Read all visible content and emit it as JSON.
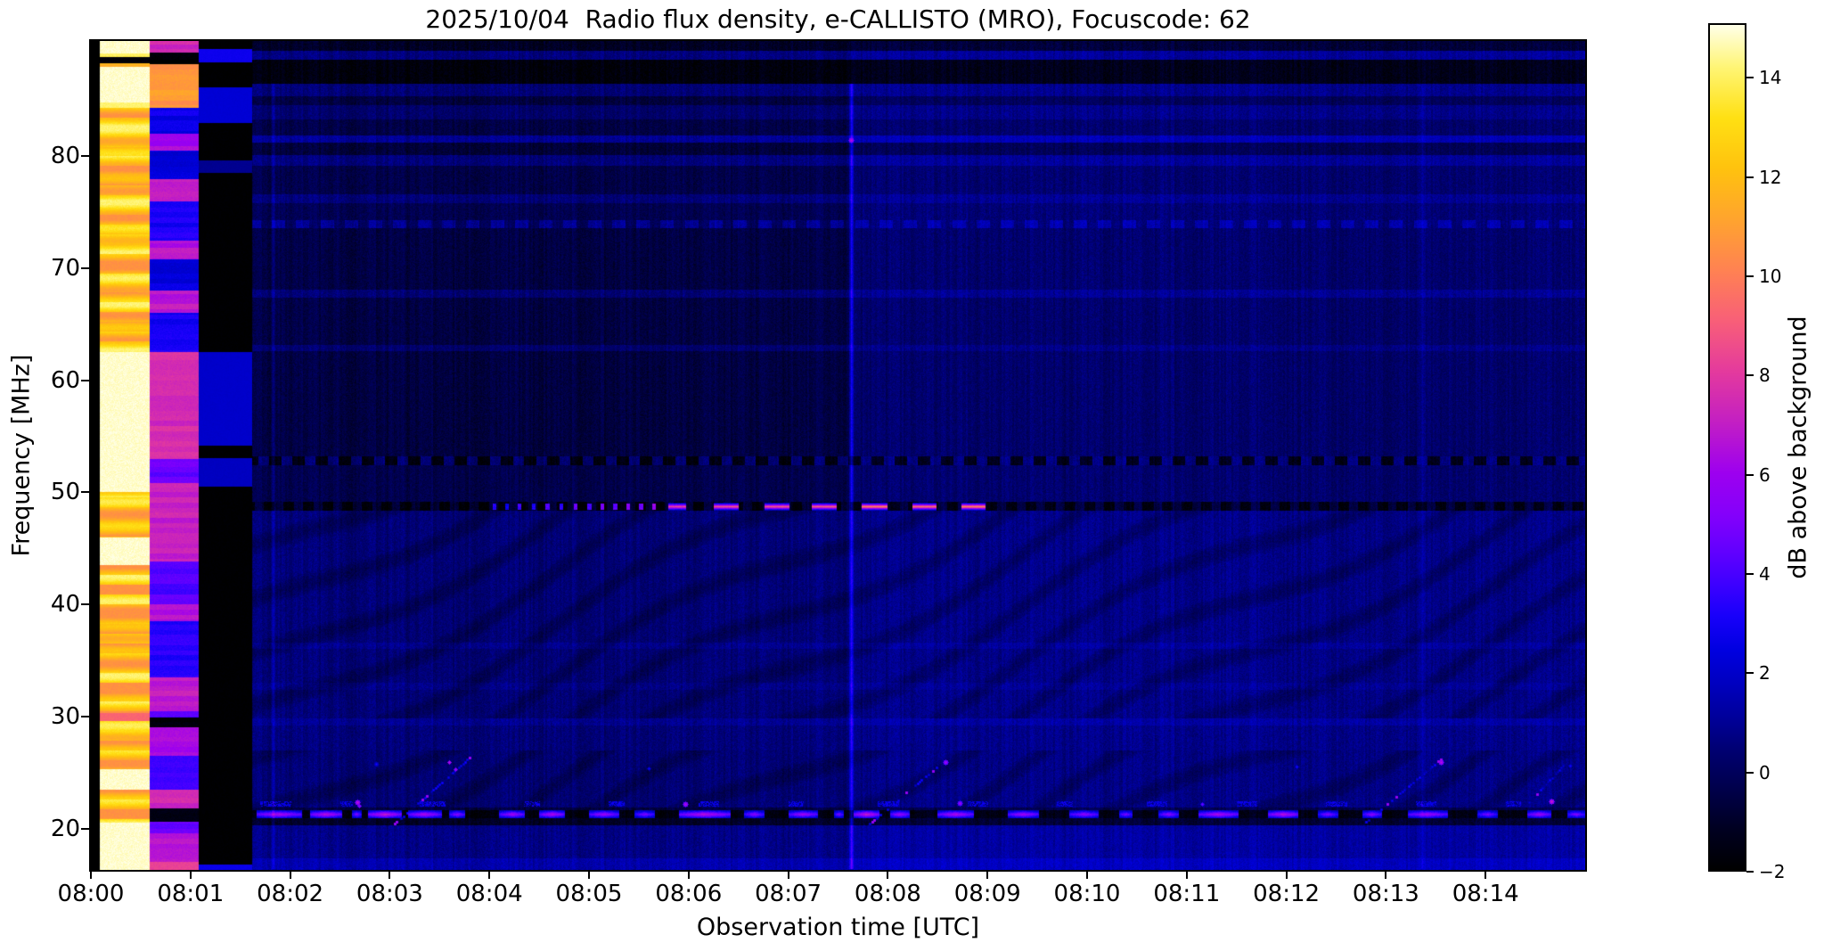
{
  "title": "2025/10/04  Radio flux density, e-CALLISTO (MRO), Focuscode: 62",
  "axes": {
    "x": {
      "label": "Observation time [UTC]",
      "tick_labels": [
        "08:00",
        "08:01",
        "08:02",
        "08:03",
        "08:04",
        "08:05",
        "08:06",
        "08:07",
        "08:08",
        "08:09",
        "08:10",
        "08:11",
        "08:12",
        "08:13",
        "08:14"
      ],
      "tick_minutes": [
        0,
        1,
        2,
        3,
        4,
        5,
        6,
        7,
        8,
        9,
        10,
        11,
        12,
        13,
        14
      ],
      "range_minutes": [
        0,
        15
      ]
    },
    "y": {
      "label": "Frequency [MHz]",
      "tick_labels": [
        "80",
        "70",
        "60",
        "50",
        "40",
        "30",
        "20"
      ],
      "tick_values": [
        80,
        70,
        60,
        50,
        40,
        30,
        20
      ],
      "range_mhz": [
        16.3,
        90.3
      ]
    }
  },
  "colorbar": {
    "label": "dB above background",
    "tick_labels": [
      "14",
      "12",
      "10",
      "8",
      "6",
      "4",
      "2",
      "0",
      "−2"
    ],
    "tick_values": [
      14,
      12,
      10,
      8,
      6,
      4,
      2,
      0,
      -2
    ],
    "vmin": -2,
    "vmax": 15.1,
    "stops": [
      [
        0.0,
        "#000000"
      ],
      [
        0.05,
        "#000022"
      ],
      [
        0.09,
        "#000046"
      ],
      [
        0.14,
        "#000070"
      ],
      [
        0.18,
        "#00009a"
      ],
      [
        0.22,
        "#0000bf"
      ],
      [
        0.26,
        "#0000e0"
      ],
      [
        0.3,
        "#1800fa"
      ],
      [
        0.335,
        "#3a00ff"
      ],
      [
        0.375,
        "#6000ff"
      ],
      [
        0.42,
        "#8400fb"
      ],
      [
        0.47,
        "#9d00ef"
      ],
      [
        0.53,
        "#c31fc3"
      ],
      [
        0.59,
        "#e43a9d"
      ],
      [
        0.65,
        "#f85f78"
      ],
      [
        0.71,
        "#ff8252"
      ],
      [
        0.77,
        "#ffa42e"
      ],
      [
        0.83,
        "#ffc20e"
      ],
      [
        0.89,
        "#ffe013"
      ],
      [
        0.95,
        "#fff575"
      ],
      [
        1.0,
        "#ffffe8"
      ]
    ]
  },
  "chart_data": {
    "type": "heatmap",
    "title": "2025/10/04  Radio flux density, e-CALLISTO (MRO), Focuscode: 62",
    "xlabel": "Observation time [UTC]",
    "ylabel": "Frequency [MHz]",
    "start_time_utc": "08:00",
    "end_time_utc": "08:15",
    "freq_range_mhz": [
      16.3,
      90.3
    ],
    "value_range_db": [
      -2,
      15.1
    ],
    "features": {
      "split_min": 7.63,
      "calibration": {
        "black_end_min": 0.09,
        "col1": {
          "end_min": 0.59,
          "white_zones": [
            [
              89.2,
              90.3
            ],
            [
              84.8,
              88.0
            ],
            [
              50.0,
              62.5
            ],
            [
              43.5,
              46.0
            ],
            [
              23.5,
              25.3
            ],
            [
              16.3,
              20.5
            ]
          ],
          "black_rows": [
            [
              88.3,
              88.9
            ]
          ],
          "pink_rows": [
            [
              29.6,
              30.3
            ]
          ]
        },
        "col2": {
          "end_min": 1.08,
          "overrides": [
            [
              90.3,
              89.3,
              7.3
            ],
            [
              89.3,
              88.2,
              -1.9
            ],
            [
              88.2,
              84.3,
              10.8
            ],
            [
              84.3,
              82.0,
              2.6
            ],
            [
              82.0,
              80.5,
              6.3
            ],
            [
              80.5,
              78.0,
              2.4
            ],
            [
              78.0,
              76.0,
              7.1
            ],
            [
              76.0,
              72.5,
              3.2
            ],
            [
              72.5,
              70.8,
              6.7
            ],
            [
              70.8,
              68.0,
              2.5
            ],
            [
              68.0,
              66.0,
              6.9
            ],
            [
              66.0,
              62.5,
              3.0
            ],
            [
              62.5,
              53.0,
              7.6
            ],
            [
              53.0,
              50.8,
              4.6
            ],
            [
              50.8,
              43.8,
              7.2
            ],
            [
              43.8,
              40.0,
              4.2
            ],
            [
              40.0,
              38.5,
              6.7
            ],
            [
              38.5,
              33.5,
              3.4
            ],
            [
              33.5,
              30.5,
              6.9
            ],
            [
              30.5,
              29.9,
              4.0
            ],
            [
              29.9,
              29.0,
              -1.9
            ],
            [
              29.0,
              26.5,
              6.3
            ],
            [
              26.5,
              23.5,
              3.6
            ],
            [
              23.5,
              21.8,
              7.3
            ],
            [
              21.8,
              20.6,
              -1.9
            ],
            [
              20.6,
              19.6,
              4.4
            ],
            [
              19.6,
              17.0,
              6.8
            ],
            [
              17.0,
              16.3,
              8.2
            ]
          ]
        },
        "col3": {
          "end_min": 1.62,
          "blue_rows": [
            [
              88.4,
              89.6,
              2.8
            ],
            [
              83.0,
              86.2,
              2.2
            ],
            [
              78.5,
              79.6,
              0.9
            ],
            [
              54.2,
              62.5,
              2.0
            ],
            [
              50.5,
              53.1,
              1.8
            ],
            [
              16.3,
              16.8,
              2.7
            ]
          ]
        }
      },
      "rows": [
        [
          90.3,
          89.4,
          -1.1,
          -0.7
        ],
        [
          89.4,
          88.6,
          0.6,
          1.05
        ],
        [
          88.6,
          86.5,
          -1.7,
          -1.35
        ],
        [
          86.5,
          85.4,
          0.45,
          0.85
        ],
        [
          85.4,
          84.6,
          -0.6,
          -0.05
        ],
        [
          84.6,
          83.3,
          0.25,
          0.75
        ],
        [
          83.3,
          81.9,
          -0.45,
          0.25
        ],
        [
          81.9,
          81.2,
          1.0,
          1.55
        ],
        [
          81.2,
          80.1,
          -0.7,
          -0.15
        ],
        [
          80.1,
          79.2,
          0.55,
          1.05
        ],
        [
          79.2,
          76.6,
          -0.4,
          0.35
        ],
        [
          76.6,
          75.8,
          0.5,
          0.95
        ],
        [
          75.8,
          74.3,
          -0.25,
          0.45
        ],
        [
          74.3,
          73.6,
          0.55,
          1.05
        ],
        [
          73.6,
          68.1,
          -0.5,
          0.3
        ],
        [
          68.1,
          67.4,
          0.4,
          0.95
        ],
        [
          67.4,
          63.2,
          -0.5,
          0.25
        ],
        [
          63.2,
          62.6,
          0.3,
          0.75
        ],
        [
          62.6,
          53.2,
          -0.55,
          0.25
        ],
        [
          53.2,
          52.4,
          -0.9,
          -0.6
        ],
        [
          52.4,
          49.15,
          -0.35,
          0.3
        ],
        [
          49.15,
          48.4,
          -1.35,
          -1.1
        ],
        [
          48.4,
          36.6,
          0.45,
          0.75
        ],
        [
          36.6,
          36.0,
          0.85,
          1.15
        ],
        [
          36.0,
          33.0,
          0.45,
          0.75
        ],
        [
          33.0,
          32.4,
          0.75,
          1.05
        ],
        [
          32.4,
          29.8,
          0.45,
          0.75
        ],
        [
          29.8,
          29.2,
          0.9,
          1.25
        ],
        [
          29.2,
          27.0,
          0.5,
          0.8
        ],
        [
          27.0,
          21.9,
          0.4,
          0.72
        ],
        [
          21.9,
          21.6,
          -0.6,
          -0.3
        ],
        [
          21.6,
          20.9,
          -1.7,
          -1.5
        ],
        [
          20.9,
          20.3,
          -1.1,
          -0.8
        ],
        [
          20.3,
          17.3,
          0.75,
          1.2
        ],
        [
          17.3,
          16.3,
          1.4,
          1.8
        ]
      ],
      "wavy_zones": [
        [
          48.4,
          29.8
        ],
        [
          27.0,
          21.9
        ]
      ],
      "dash_row_53mhz": [
        53.2,
        52.4
      ],
      "dash_row_74mhz": [
        74.3,
        73.6
      ],
      "burst_row_49mhz": {
        "f_range": [
          49.15,
          48.4
        ],
        "bright_dashes": [
          [
            5.8,
            5.97,
            8.6
          ],
          [
            6.25,
            6.49,
            9.0
          ],
          [
            6.76,
            7.0,
            9.2
          ],
          [
            7.24,
            7.48,
            9.4
          ],
          [
            7.74,
            7.99,
            10.4
          ],
          [
            8.25,
            8.48,
            10.0
          ],
          [
            8.74,
            8.97,
            10.5
          ]
        ],
        "leading_dots": [
          [
            4.05,
            3.4
          ],
          [
            4.17,
            2.8
          ],
          [
            4.3,
            3.8
          ],
          [
            4.44,
            3.1
          ],
          [
            4.58,
            4.2
          ],
          [
            4.72,
            3.5
          ],
          [
            4.86,
            4.6
          ],
          [
            5.0,
            3.9
          ],
          [
            5.13,
            5.0
          ],
          [
            5.26,
            4.3
          ],
          [
            5.39,
            5.4
          ],
          [
            5.52,
            4.7
          ],
          [
            5.65,
            5.8
          ]
        ]
      },
      "band_21mhz": {
        "f_range": [
          21.6,
          20.9
        ],
        "f_center": 21.25,
        "segments": [
          [
            1.66,
            2.12,
            6.6
          ],
          [
            2.2,
            2.52,
            7.0
          ],
          [
            2.62,
            2.72,
            5.2
          ],
          [
            2.78,
            3.12,
            7.4
          ],
          [
            3.18,
            3.52,
            6.6
          ],
          [
            3.6,
            3.76,
            5.6
          ],
          [
            4.1,
            4.36,
            6.2
          ],
          [
            4.5,
            4.76,
            6.6
          ],
          [
            5.0,
            5.3,
            6.2
          ],
          [
            5.46,
            5.66,
            5.2
          ],
          [
            5.9,
            6.42,
            7.0
          ],
          [
            6.56,
            6.76,
            5.6
          ],
          [
            7.0,
            7.3,
            6.2
          ],
          [
            7.46,
            7.56,
            5.0
          ],
          [
            7.66,
            7.92,
            7.4
          ],
          [
            8.02,
            8.22,
            6.2
          ],
          [
            8.5,
            8.86,
            6.6
          ],
          [
            9.2,
            9.52,
            6.2
          ],
          [
            9.82,
            10.12,
            5.8
          ],
          [
            10.32,
            10.46,
            5.2
          ],
          [
            10.72,
            10.92,
            5.6
          ],
          [
            11.12,
            11.52,
            6.6
          ],
          [
            11.82,
            12.12,
            7.0
          ],
          [
            12.32,
            12.52,
            5.2
          ],
          [
            12.76,
            12.96,
            5.6
          ],
          [
            13.22,
            13.62,
            6.2
          ],
          [
            13.92,
            14.12,
            5.2
          ],
          [
            14.42,
            14.66,
            6.2
          ],
          [
            14.82,
            15.0,
            5.4
          ]
        ]
      },
      "specks_22mhz": {
        "f_range": [
          22.45,
          22.05
        ],
        "t_spans": [
          [
            1.7,
            2.0
          ],
          [
            2.5,
            2.62
          ],
          [
            3.3,
            3.55
          ],
          [
            4.35,
            4.5
          ],
          [
            5.2,
            5.35
          ],
          [
            6.1,
            6.3
          ],
          [
            7.0,
            7.15
          ],
          [
            7.9,
            8.1
          ],
          [
            8.8,
            9.0
          ],
          [
            9.7,
            9.85
          ],
          [
            10.6,
            10.8
          ],
          [
            11.5,
            11.7
          ],
          [
            12.4,
            12.6
          ],
          [
            13.3,
            13.5
          ],
          [
            14.2,
            14.35
          ]
        ],
        "value": 2.6
      },
      "diagonal_traces": [
        {
          "t0": 3.05,
          "f0": 20.4,
          "t1": 3.8,
          "f1": 26.3
        },
        {
          "t0": 7.82,
          "f0": 20.4,
          "t1": 8.6,
          "f1": 26.3
        },
        {
          "t0": 12.78,
          "f0": 20.4,
          "t1": 13.57,
          "f1": 26.3
        },
        {
          "t0": 14.38,
          "f0": 21.8,
          "t1": 14.78,
          "f1": 25.6
        }
      ],
      "vertical_lines": [
        {
          "t": 7.63,
          "w": 0.022,
          "dv": 2.8
        },
        {
          "t": 1.83,
          "w": 0.012,
          "dv": 1.2
        },
        {
          "t": 13.36,
          "w": 0.012,
          "dv": 0.7
        }
      ],
      "dots": [
        {
          "t": 2.67,
          "f": 22.35,
          "v": 7.2,
          "r": 3
        },
        {
          "t": 2.69,
          "f": 22.0,
          "v": 6.0,
          "r": 2
        },
        {
          "t": 2.86,
          "f": 25.8,
          "v": 3.5,
          "r": 3
        },
        {
          "t": 5.97,
          "f": 22.2,
          "v": 6.8,
          "r": 3
        },
        {
          "t": 5.6,
          "f": 25.4,
          "v": 3.2,
          "r": 2
        },
        {
          "t": 8.72,
          "f": 22.3,
          "v": 6.2,
          "r": 3
        },
        {
          "t": 11.15,
          "f": 22.2,
          "v": 5.0,
          "r": 2
        },
        {
          "t": 14.66,
          "f": 22.4,
          "v": 7.5,
          "r": 3
        },
        {
          "t": 7.63,
          "f": 81.5,
          "v": 7.0,
          "r": 3
        },
        {
          "t": 13.55,
          "f": 25.9,
          "v": 7.0,
          "r": 3
        },
        {
          "t": 8.58,
          "f": 25.9,
          "v": 6.4,
          "r": 3
        },
        {
          "t": 3.6,
          "f": 25.9,
          "v": 7.0,
          "r": 2
        },
        {
          "t": 3.66,
          "f": 25.3,
          "v": 6.2,
          "r": 2
        },
        {
          "t": 12.1,
          "f": 25.5,
          "v": 3.5,
          "r": 2
        },
        {
          "t": 14.85,
          "f": 25.6,
          "v": 3.4,
          "r": 2
        }
      ]
    }
  }
}
